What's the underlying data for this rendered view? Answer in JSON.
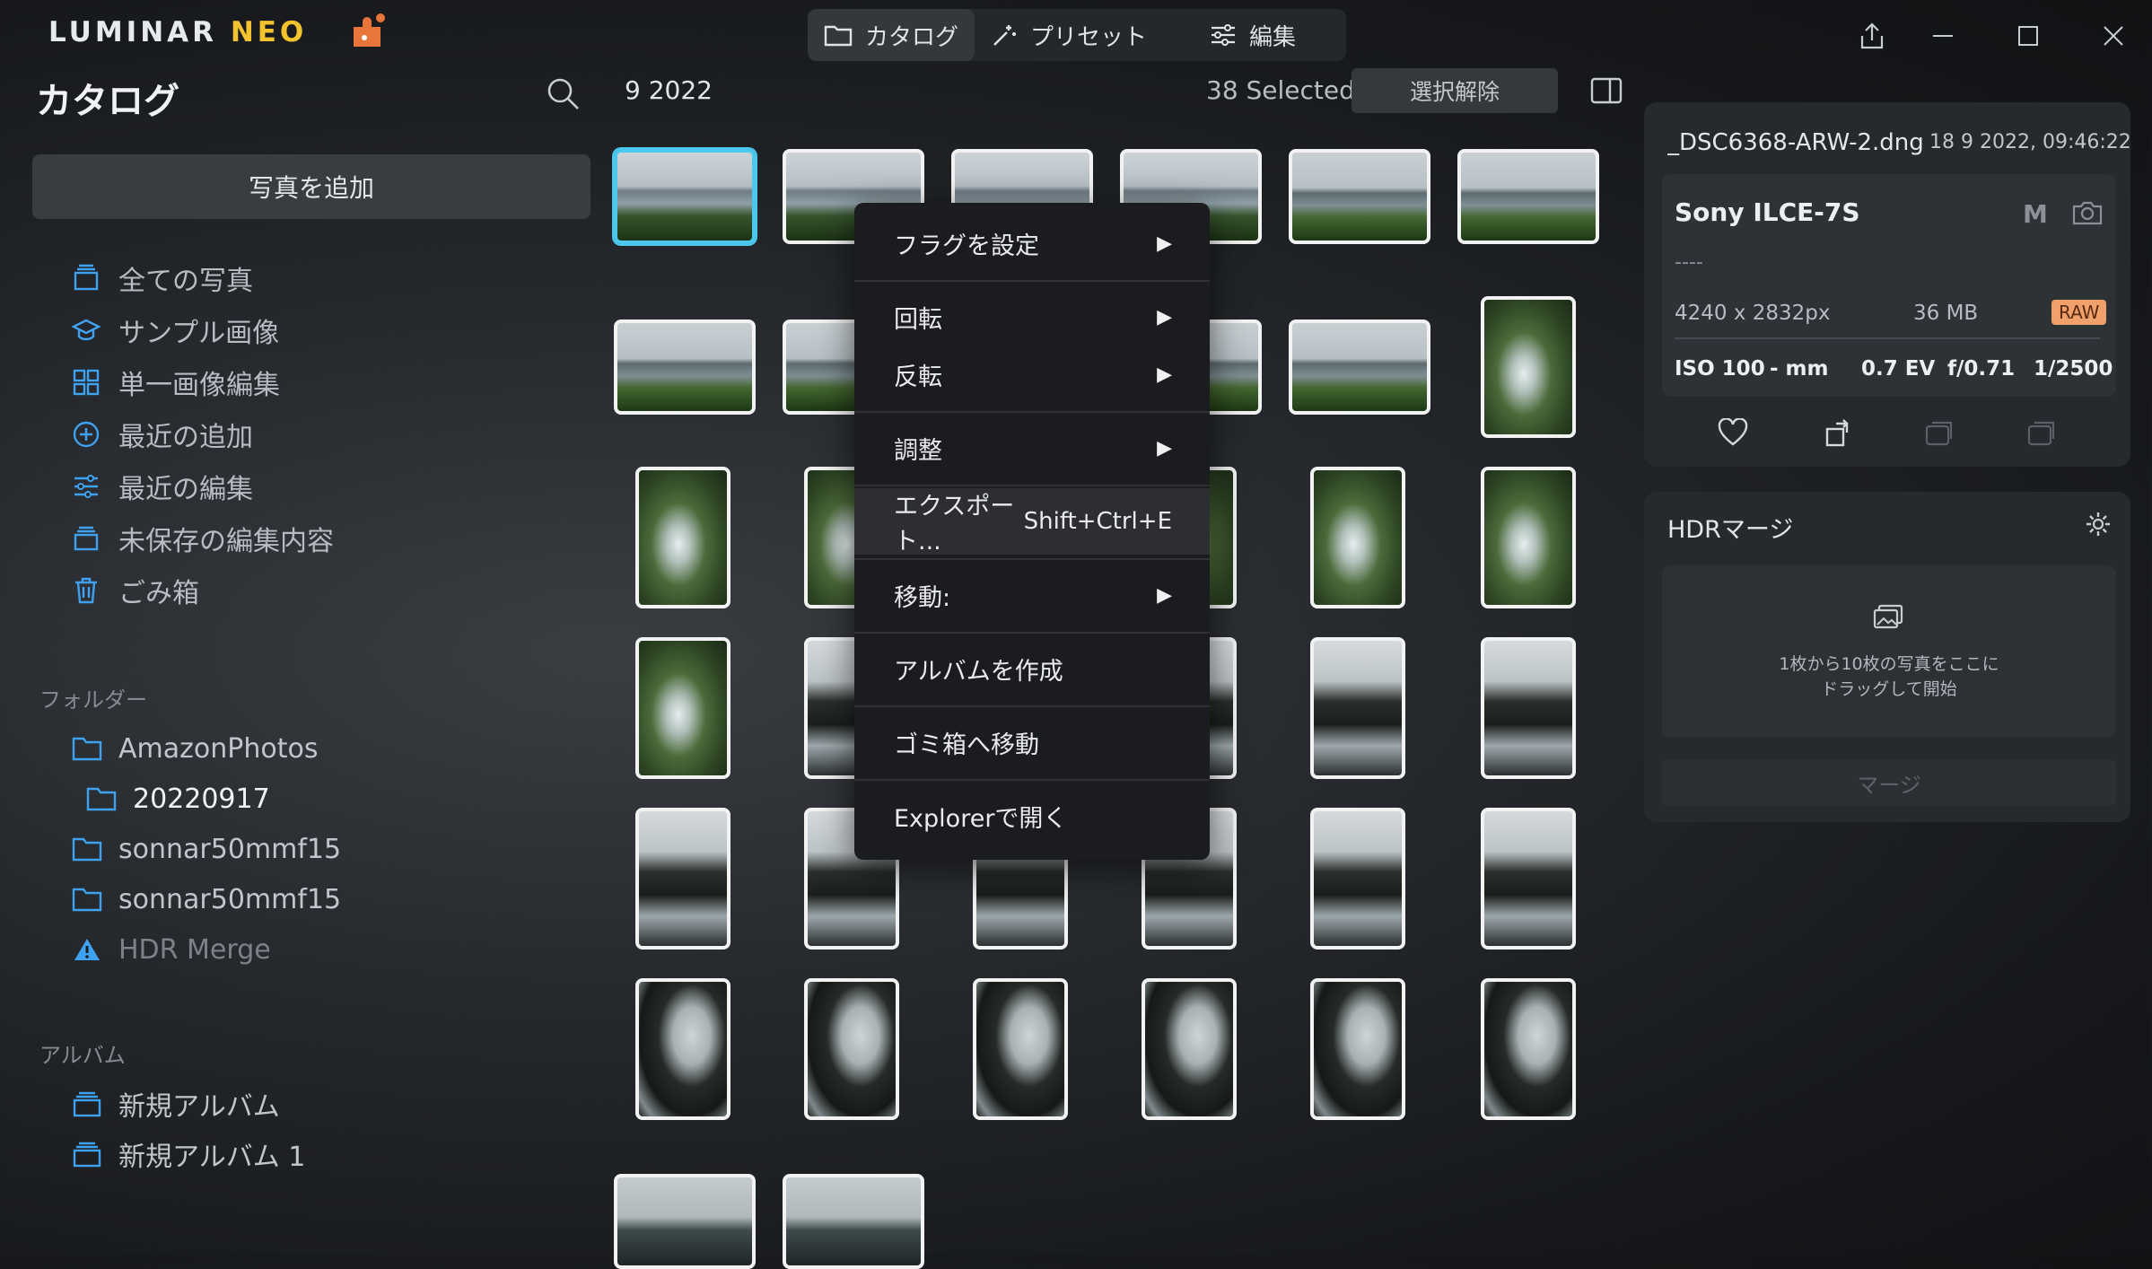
{
  "app": {
    "logo_main": "LUMINAR",
    "logo_neo": "NEO"
  },
  "tabs": [
    {
      "label": "カタログ",
      "icon": "folder-icon"
    },
    {
      "label": "プリセット",
      "icon": "magic-wand-icon"
    },
    {
      "label": "編集",
      "icon": "sliders-icon"
    }
  ],
  "sidebar": {
    "title": "カタログ",
    "add_photo": "写真を追加",
    "items": [
      {
        "label": "全ての写真",
        "icon": "all-photos-icon"
      },
      {
        "label": "サンプル画像",
        "icon": "graduation-cap-icon"
      },
      {
        "label": "単一画像編集",
        "icon": "grid-icon"
      },
      {
        "label": "最近の追加",
        "icon": "plus-circle-icon"
      },
      {
        "label": "最近の編集",
        "icon": "sliders-icon"
      },
      {
        "label": "未保存の編集内容",
        "icon": "stack-icon"
      },
      {
        "label": "ごみ箱",
        "icon": "trash-icon"
      }
    ],
    "folders_heading": "フォルダー",
    "folders": [
      {
        "label": "AmazonPhotos",
        "icon": "folder-icon"
      },
      {
        "label": "20220917",
        "icon": "folder-icon"
      },
      {
        "label": "sonnar50mmf15",
        "icon": "folder-icon"
      },
      {
        "label": "sonnar50mmf15",
        "icon": "folder-icon"
      },
      {
        "label": "HDR Merge",
        "icon": "warning-icon"
      }
    ],
    "albums_heading": "アルバム",
    "albums": [
      {
        "label": "新規アルバム",
        "icon": "album-icon"
      },
      {
        "label": "新規アルバム 1",
        "icon": "album-icon"
      }
    ]
  },
  "gallery": {
    "date": "9 2022",
    "selected": "38 Selected",
    "deselect": "選択解除"
  },
  "context_menu": {
    "flag": "フラグを設定",
    "rotate": "回転",
    "flip": "反転",
    "adjust": "調整",
    "export": "エクスポート...",
    "export_shortcut": "Shift+Ctrl+E",
    "move": "移動:",
    "create_album": "アルバムを作成",
    "trash": "ゴミ箱へ移動",
    "explorer": "Explorerで開く"
  },
  "info": {
    "filename": "_DSC6368-ARW-2.dng",
    "datetime": "18 9 2022, 09:46:22",
    "camera": "Sony ILCE-7S",
    "mode": "M",
    "lens": "----",
    "resolution": "4240 x 2832px",
    "size": "36 MB",
    "format": "RAW",
    "iso": "ISO 100",
    "focal": "- mm",
    "ev": "0.7 EV",
    "aperture": "f/0.71",
    "shutter": "1/2500"
  },
  "hdr": {
    "title": "HDRマージ",
    "drop_line1": "1枚から10枚の写真をここに",
    "drop_line2": "ドラッグして開始",
    "merge": "マージ"
  },
  "colors": {
    "accent": "#4cc8ee",
    "logo_neo": "#f3c22f",
    "icon_blue": "#3fa2f0",
    "raw_badge": "#f0a06a"
  }
}
